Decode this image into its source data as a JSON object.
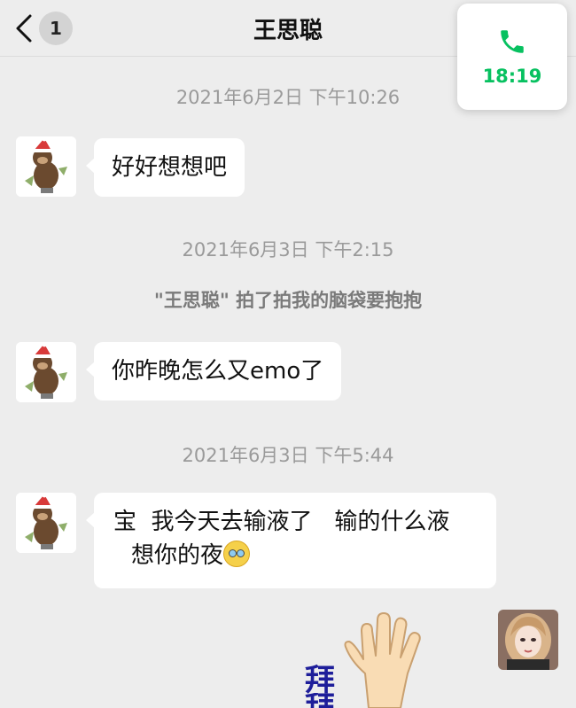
{
  "header": {
    "back_badge": "1",
    "title": "王思聪"
  },
  "call_card": {
    "icon": "phone-icon",
    "time": "18:19",
    "accent": "#07c160"
  },
  "messages": [
    {
      "timestamp": "2021年6月2日 下午10:26",
      "text": "好好想想吧"
    },
    {
      "timestamp": "2021年6月3日 下午2:15",
      "system": "\"王思聪\" 拍了拍我的脑袋要抱抱",
      "text": "你昨晚怎么又emo了"
    },
    {
      "timestamp": "2021年6月3日 下午5:44",
      "line1": "宝  我今天去输液了   输的什么液",
      "line2": "想你的夜"
    }
  ],
  "sticker": {
    "text": "拜",
    "text2": "拜"
  }
}
